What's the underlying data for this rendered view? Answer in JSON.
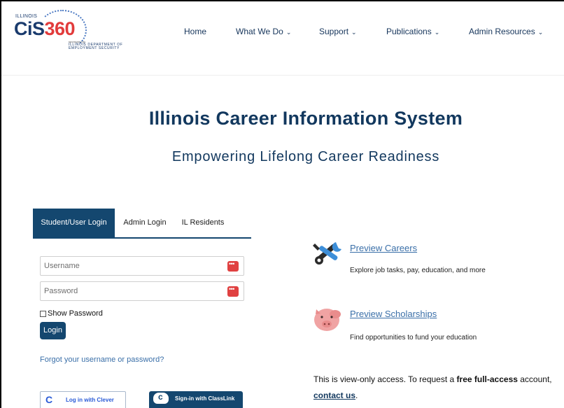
{
  "header": {
    "logo": {
      "state": "ILLINOIS",
      "brand_part1": "CiS",
      "brand_part2": "360",
      "sponsored": "sponsored by",
      "sponsor": "ILLINOIS DEPARTMENT OF EMPLOYMENT SECURITY"
    },
    "nav": [
      {
        "label": "Home",
        "dropdown": false
      },
      {
        "label": "What We Do",
        "dropdown": true
      },
      {
        "label": "Support",
        "dropdown": true
      },
      {
        "label": "Publications",
        "dropdown": true
      },
      {
        "label": "Admin Resources",
        "dropdown": true
      }
    ]
  },
  "hero": {
    "title": "Illinois Career Information System",
    "subtitle": "Empowering Lifelong Career Readiness"
  },
  "login": {
    "tabs": [
      {
        "label": "Student/User Login",
        "active": true
      },
      {
        "label": "Admin Login",
        "active": false
      },
      {
        "label": "IL Residents",
        "active": false
      }
    ],
    "username_placeholder": "Username",
    "password_placeholder": "Password",
    "show_password_label": "Show Password",
    "login_button": "Login",
    "forgot_link": "Forgot your username or password?",
    "clever_label": "Log in with Clever",
    "classlink_label": "Sign-in with ClassLink"
  },
  "previews": [
    {
      "icon": "tools-icon",
      "link": "Preview Careers",
      "description": "Explore job tasks, pay, education, and more"
    },
    {
      "icon": "piggy-bank-icon",
      "link": "Preview Scholarships",
      "description": "Find opportunities to fund your education"
    }
  ],
  "notice": {
    "text_before": "This is view-only access. To request a ",
    "bold": "free full-access",
    "text_after": " account,",
    "contact_link": "contact us",
    "contact_after": "."
  },
  "colors": {
    "navy": "#14476f",
    "title": "#12385e",
    "link": "#3a6fa8",
    "brand_red": "#e23b3b"
  }
}
